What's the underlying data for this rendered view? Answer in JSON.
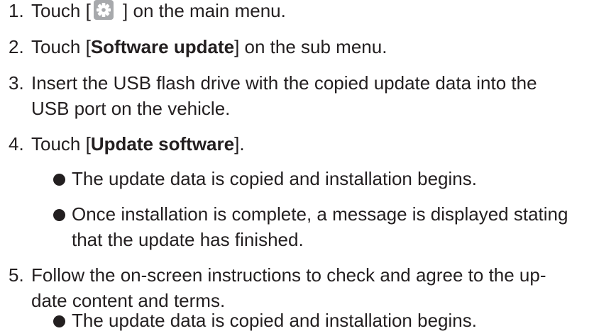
{
  "steps": [
    {
      "number": "1.",
      "pre": "Touch [",
      "icon": "gear-icon",
      "post": " ] on the main menu."
    },
    {
      "number": "2.",
      "pre": "Touch [",
      "bold": "Software update",
      "post": "] on the sub menu."
    },
    {
      "number": "3.",
      "line1": "Insert the USB flash drive with the copied update data into the",
      "line2": "USB port on the vehicle."
    },
    {
      "number": "4.",
      "pre": "Touch [",
      "bold": "Update software",
      "post": "].",
      "bullets": [
        {
          "line1": "The update data is copied and installation begins."
        },
        {
          "line1": "Once installation is complete, a message is displayed stating",
          "line2": "that the update has finished."
        }
      ]
    },
    {
      "number": "5.",
      "line1": "Follow the on-screen instructions to check and agree to the up-",
      "line2": "date content and terms.",
      "bullets": [
        {
          "line1": "The update data is copied and installation begins."
        }
      ]
    }
  ],
  "colors": {
    "text": "#231f20",
    "icon": "#a7a9ac"
  }
}
